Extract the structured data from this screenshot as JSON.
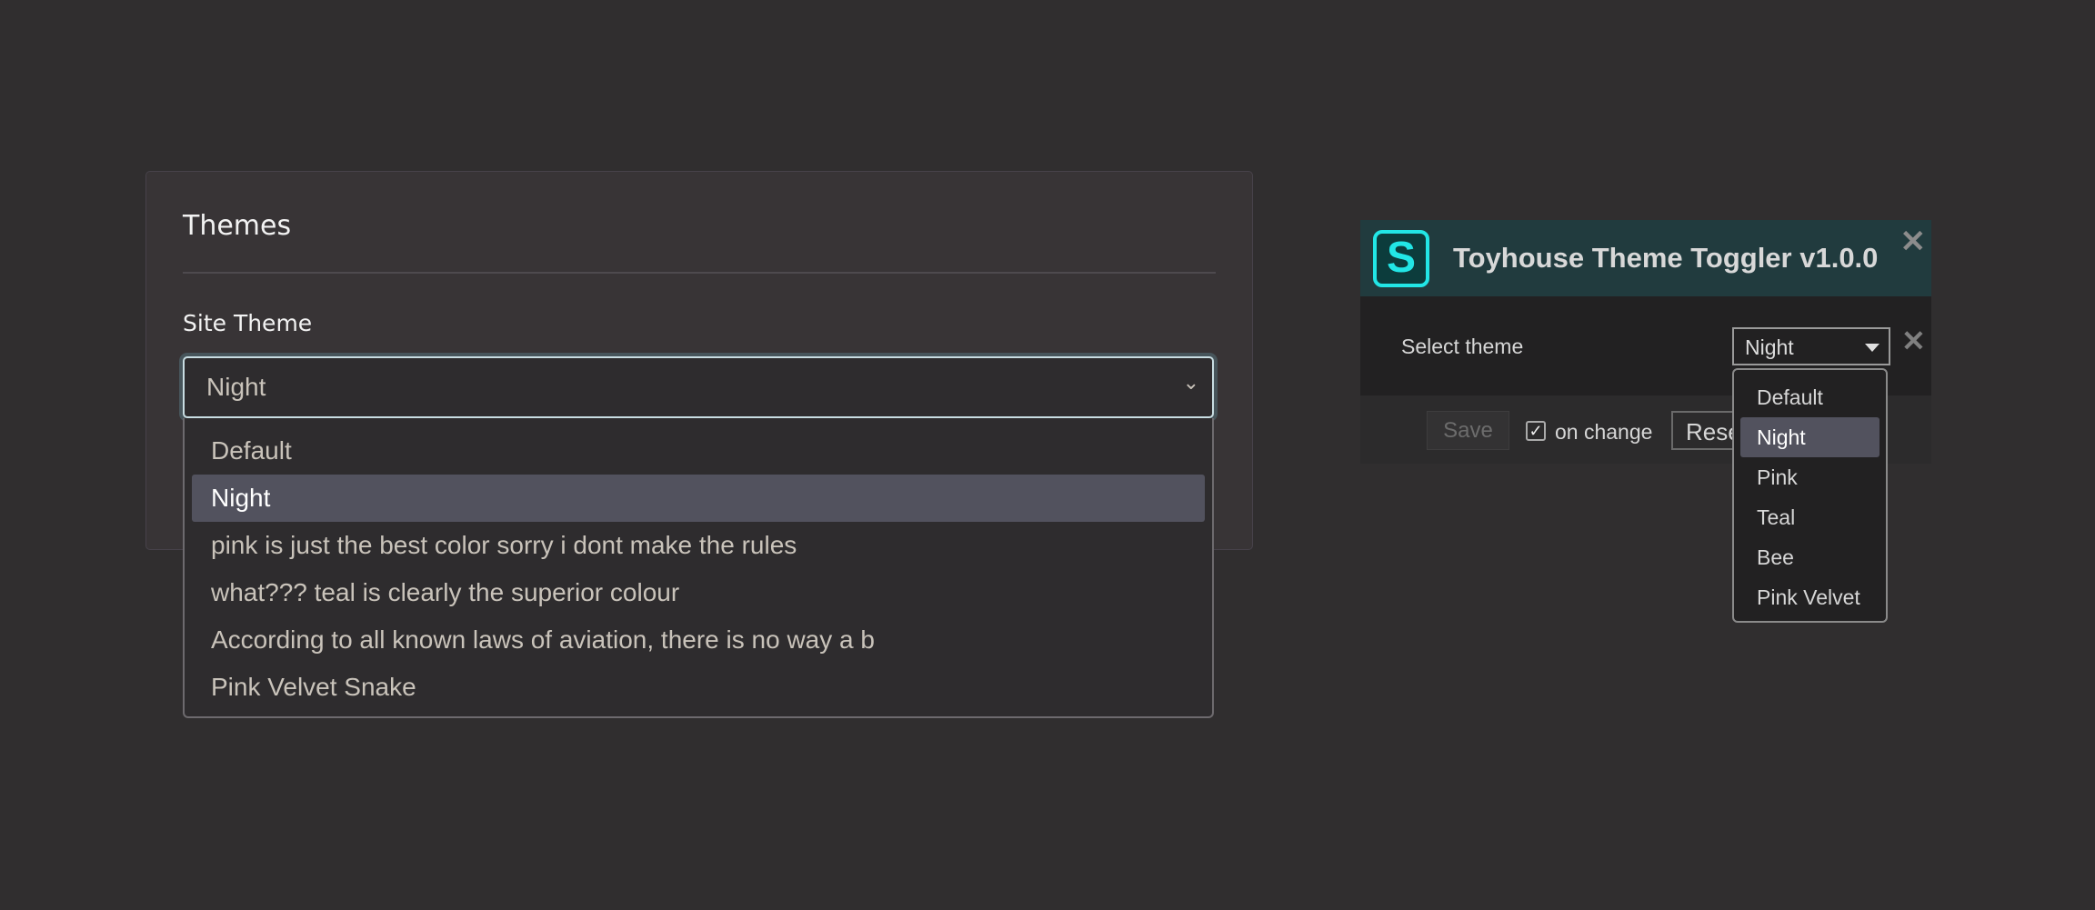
{
  "site_settings": {
    "title": "Themes",
    "site_theme_label": "Site Theme",
    "selected": "Night",
    "options": [
      "Default",
      "Night",
      "pink is just the best color sorry i dont make the rules",
      "what??? teal is clearly the superior colour",
      "According to all known laws of aviation, there is no way a b",
      "Pink Velvet Snake"
    ]
  },
  "toggler": {
    "title": "Toyhouse Theme Toggler v1.0.0",
    "logo_letter": "S",
    "select_label": "Select theme",
    "selected": "Night",
    "options": [
      "Default",
      "Night",
      "Pink",
      "Teal",
      "Bee",
      "Pink Velvet"
    ],
    "save_label": "Save",
    "on_change_label": "on change",
    "on_change_checked": true,
    "reset_label": "Reset",
    "accent_color": "#22e6e6"
  }
}
